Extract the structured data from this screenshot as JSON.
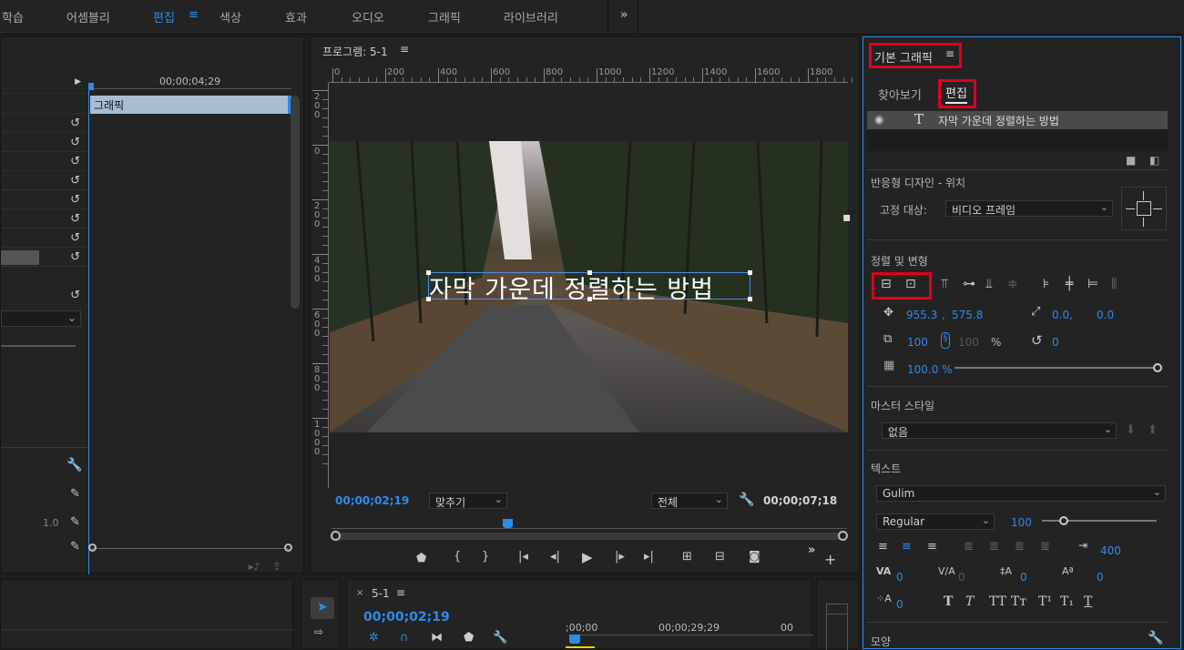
{
  "workspaces": [
    "학습",
    "어셈블리",
    "편집",
    "색상",
    "효과",
    "오디오",
    "그래픽",
    "라이브러리"
  ],
  "workspace_menu_icon": "hamburger-icon",
  "overflow_label": "»",
  "effect_controls": {
    "timecode": "00;00;04;29",
    "clip_label": "그래픽",
    "value_10": "1.0"
  },
  "program_monitor": {
    "title": "프로그램: 5-1",
    "ruler_h": [
      "0",
      "200",
      "400",
      "600",
      "800",
      "1000",
      "1200",
      "1400",
      "1600",
      "1800"
    ],
    "ruler_v": [
      [
        "2",
        "0",
        "0"
      ],
      [
        "0"
      ],
      [
        "2",
        "0",
        "0"
      ],
      [
        "4",
        "0",
        "0"
      ],
      [
        "6",
        "0",
        "0"
      ],
      [
        "8",
        "0",
        "0"
      ],
      [
        "1",
        "0",
        "0",
        "0"
      ]
    ],
    "caption": "자막 가운데 정렬하는 방법",
    "current_time": "00;00;02;19",
    "fit_label": "맞추기",
    "quality_label": "전체",
    "duration": "00;00;07;18"
  },
  "timeline": {
    "tab_label": "5-1",
    "time": "00;00;02;19",
    "ruler": [
      ";00;00",
      "00;00;29;29",
      "00"
    ]
  },
  "essential_graphics": {
    "title": "기본 그래픽",
    "tabs": [
      "찾아보기",
      "편집"
    ],
    "layer_name": "자막 가운데 정렬하는 방법",
    "responsive_title": "반응형 디자인 - 위치",
    "pin_label": "고정 대상:",
    "pin_value": "비디오 프레임",
    "align_title": "정렬 및 변형",
    "pos_x": "955.3",
    "pos_sep": ",",
    "pos_y": "575.8",
    "anchor_x": "0.0",
    "anchor_sep": ",",
    "anchor_y": "0.0",
    "scale": "100",
    "scale_h": "100",
    "scale_unit": "%",
    "rotation": "0",
    "opacity": "100.0 %",
    "opacity_level": 1.0,
    "master_title": "마스터 스타일",
    "master_value": "없음",
    "text_title": "텍스트",
    "font": "Gulim",
    "font_style": "Regular",
    "font_size": "100",
    "font_size_level": 0.2,
    "tab_width": "400",
    "kerning": "0",
    "tracking": "0",
    "leading": "0",
    "baseline": "0",
    "tsume": "0",
    "faux_styles": [
      "T",
      "T",
      "TT",
      "Tт",
      "T¹",
      "T₁",
      "T"
    ],
    "appearance_title": "모양"
  }
}
